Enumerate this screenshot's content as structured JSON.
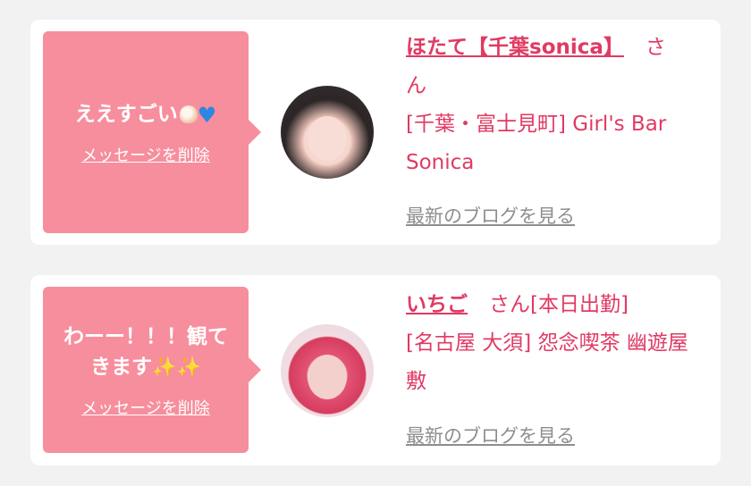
{
  "messages": [
    {
      "text": "ええすごい",
      "emojis": [
        "shell",
        "blue-heart"
      ],
      "delete_label": "メッセージを削除",
      "name": "ほたて【千葉sonica】",
      "san": "さ\nん",
      "store": "[千葉・富士見町] Girl's Bar Sonica",
      "blog_label": "最新のブログを見る"
    },
    {
      "text": "わーー！！！観て\nきます",
      "emojis": [
        "sparkles",
        "sparkles"
      ],
      "delete_label": "メッセージを削除",
      "name": "いちご",
      "san": "さん[本日出勤]",
      "store": "[名古屋 大須] 怨念喫茶 幽遊屋敷",
      "blog_label": "最新のブログを見る"
    }
  ],
  "colors": {
    "bubble": "#f78e9d",
    "accent_text": "#e03a63",
    "link_gray": "#8e8e8e",
    "background": "#f2f2f3"
  }
}
